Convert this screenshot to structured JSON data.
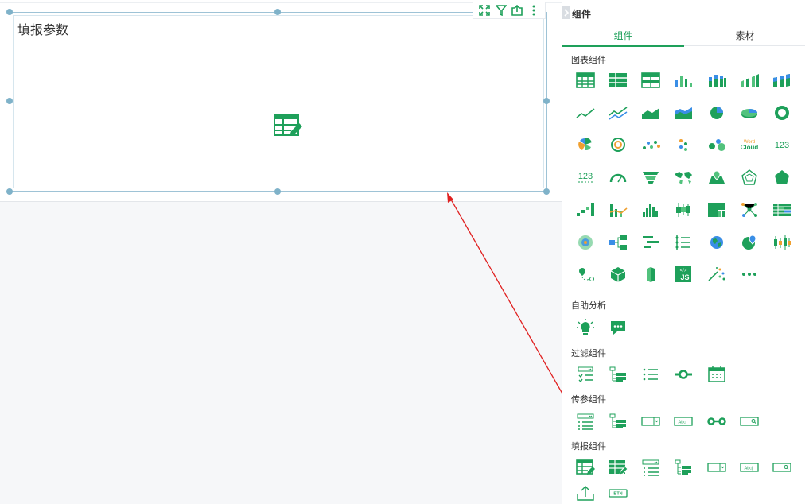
{
  "widget": {
    "title": "填报参数"
  },
  "panel": {
    "title": "组件",
    "tabs": [
      {
        "label": "组件",
        "active": true
      },
      {
        "label": "素材",
        "active": false
      }
    ]
  },
  "sections": {
    "chart": {
      "label": "图表组件",
      "icons": [
        "table-icon",
        "cross-table-icon",
        "grouped-table-icon",
        "column-chart-icon",
        "stacked-column-icon",
        "3d-column-icon",
        "3d-stacked-column-icon",
        "line-chart-icon",
        "multi-line-icon",
        "area-chart-icon",
        "stacked-area-icon",
        "pie-chart-icon",
        "3d-pie-icon",
        "donut-chart-icon",
        "rose-chart-icon",
        "ring-progress-icon",
        "scatter-icon",
        "dot-plot-icon",
        "bubble-icon",
        "word-cloud-icon",
        "kpi-number-icon",
        "kpi-number-alt-icon",
        "gauge-icon",
        "funnel-icon",
        "world-map-icon",
        "point-map-icon",
        "radar-icon",
        "radar-filled-icon",
        "waterfall-icon",
        "combo-chart-icon",
        "histogram-icon",
        "boxplot-icon",
        "treemap-icon",
        "network-icon",
        "heat-table-icon",
        "heatmap-icon",
        "tree-diagram-icon",
        "gantt-icon",
        "ranking-list-icon",
        "globe-icon",
        "location-map-icon",
        "candlestick-icon",
        "route-map-icon",
        "cube-icon",
        "3d-bar-icon",
        "js-chart-icon",
        "magic-icon",
        "more-icon"
      ]
    },
    "self": {
      "label": "自助分析",
      "icons": [
        "insight-bulb-icon",
        "chat-icon"
      ]
    },
    "filter": {
      "label": "过滤组件",
      "icons": [
        "dropdown-list-filter-icon",
        "tree-filter-icon",
        "list-filter-icon",
        "slider-filter-icon",
        "date-filter-icon"
      ]
    },
    "param": {
      "label": "传参组件",
      "icons": [
        "dropdown-list-param-icon",
        "tree-param-icon",
        "select-param-icon",
        "text-param-icon",
        "range-param-icon",
        "search-param-icon"
      ]
    },
    "fill": {
      "label": "填报组件",
      "icons": [
        "fill-table-icon",
        "fill-table-edit-icon",
        "fill-list-icon",
        "fill-tree-icon",
        "fill-select-icon",
        "fill-text-icon",
        "fill-search-icon",
        "upload-icon",
        "button-icon"
      ]
    }
  },
  "texts": {
    "word_top": "Word",
    "word_bottom": "Cloud",
    "kpi": "123",
    "js": "JS",
    "abc": "Abc|",
    "btn": "BTN"
  },
  "colors": {
    "accent": "#1ea05a",
    "accent_light": "#52c27d",
    "blue": "#3a8ee6",
    "orange": "#f0a030",
    "arrow": "#e02020",
    "handle": "#7fb2c9"
  }
}
